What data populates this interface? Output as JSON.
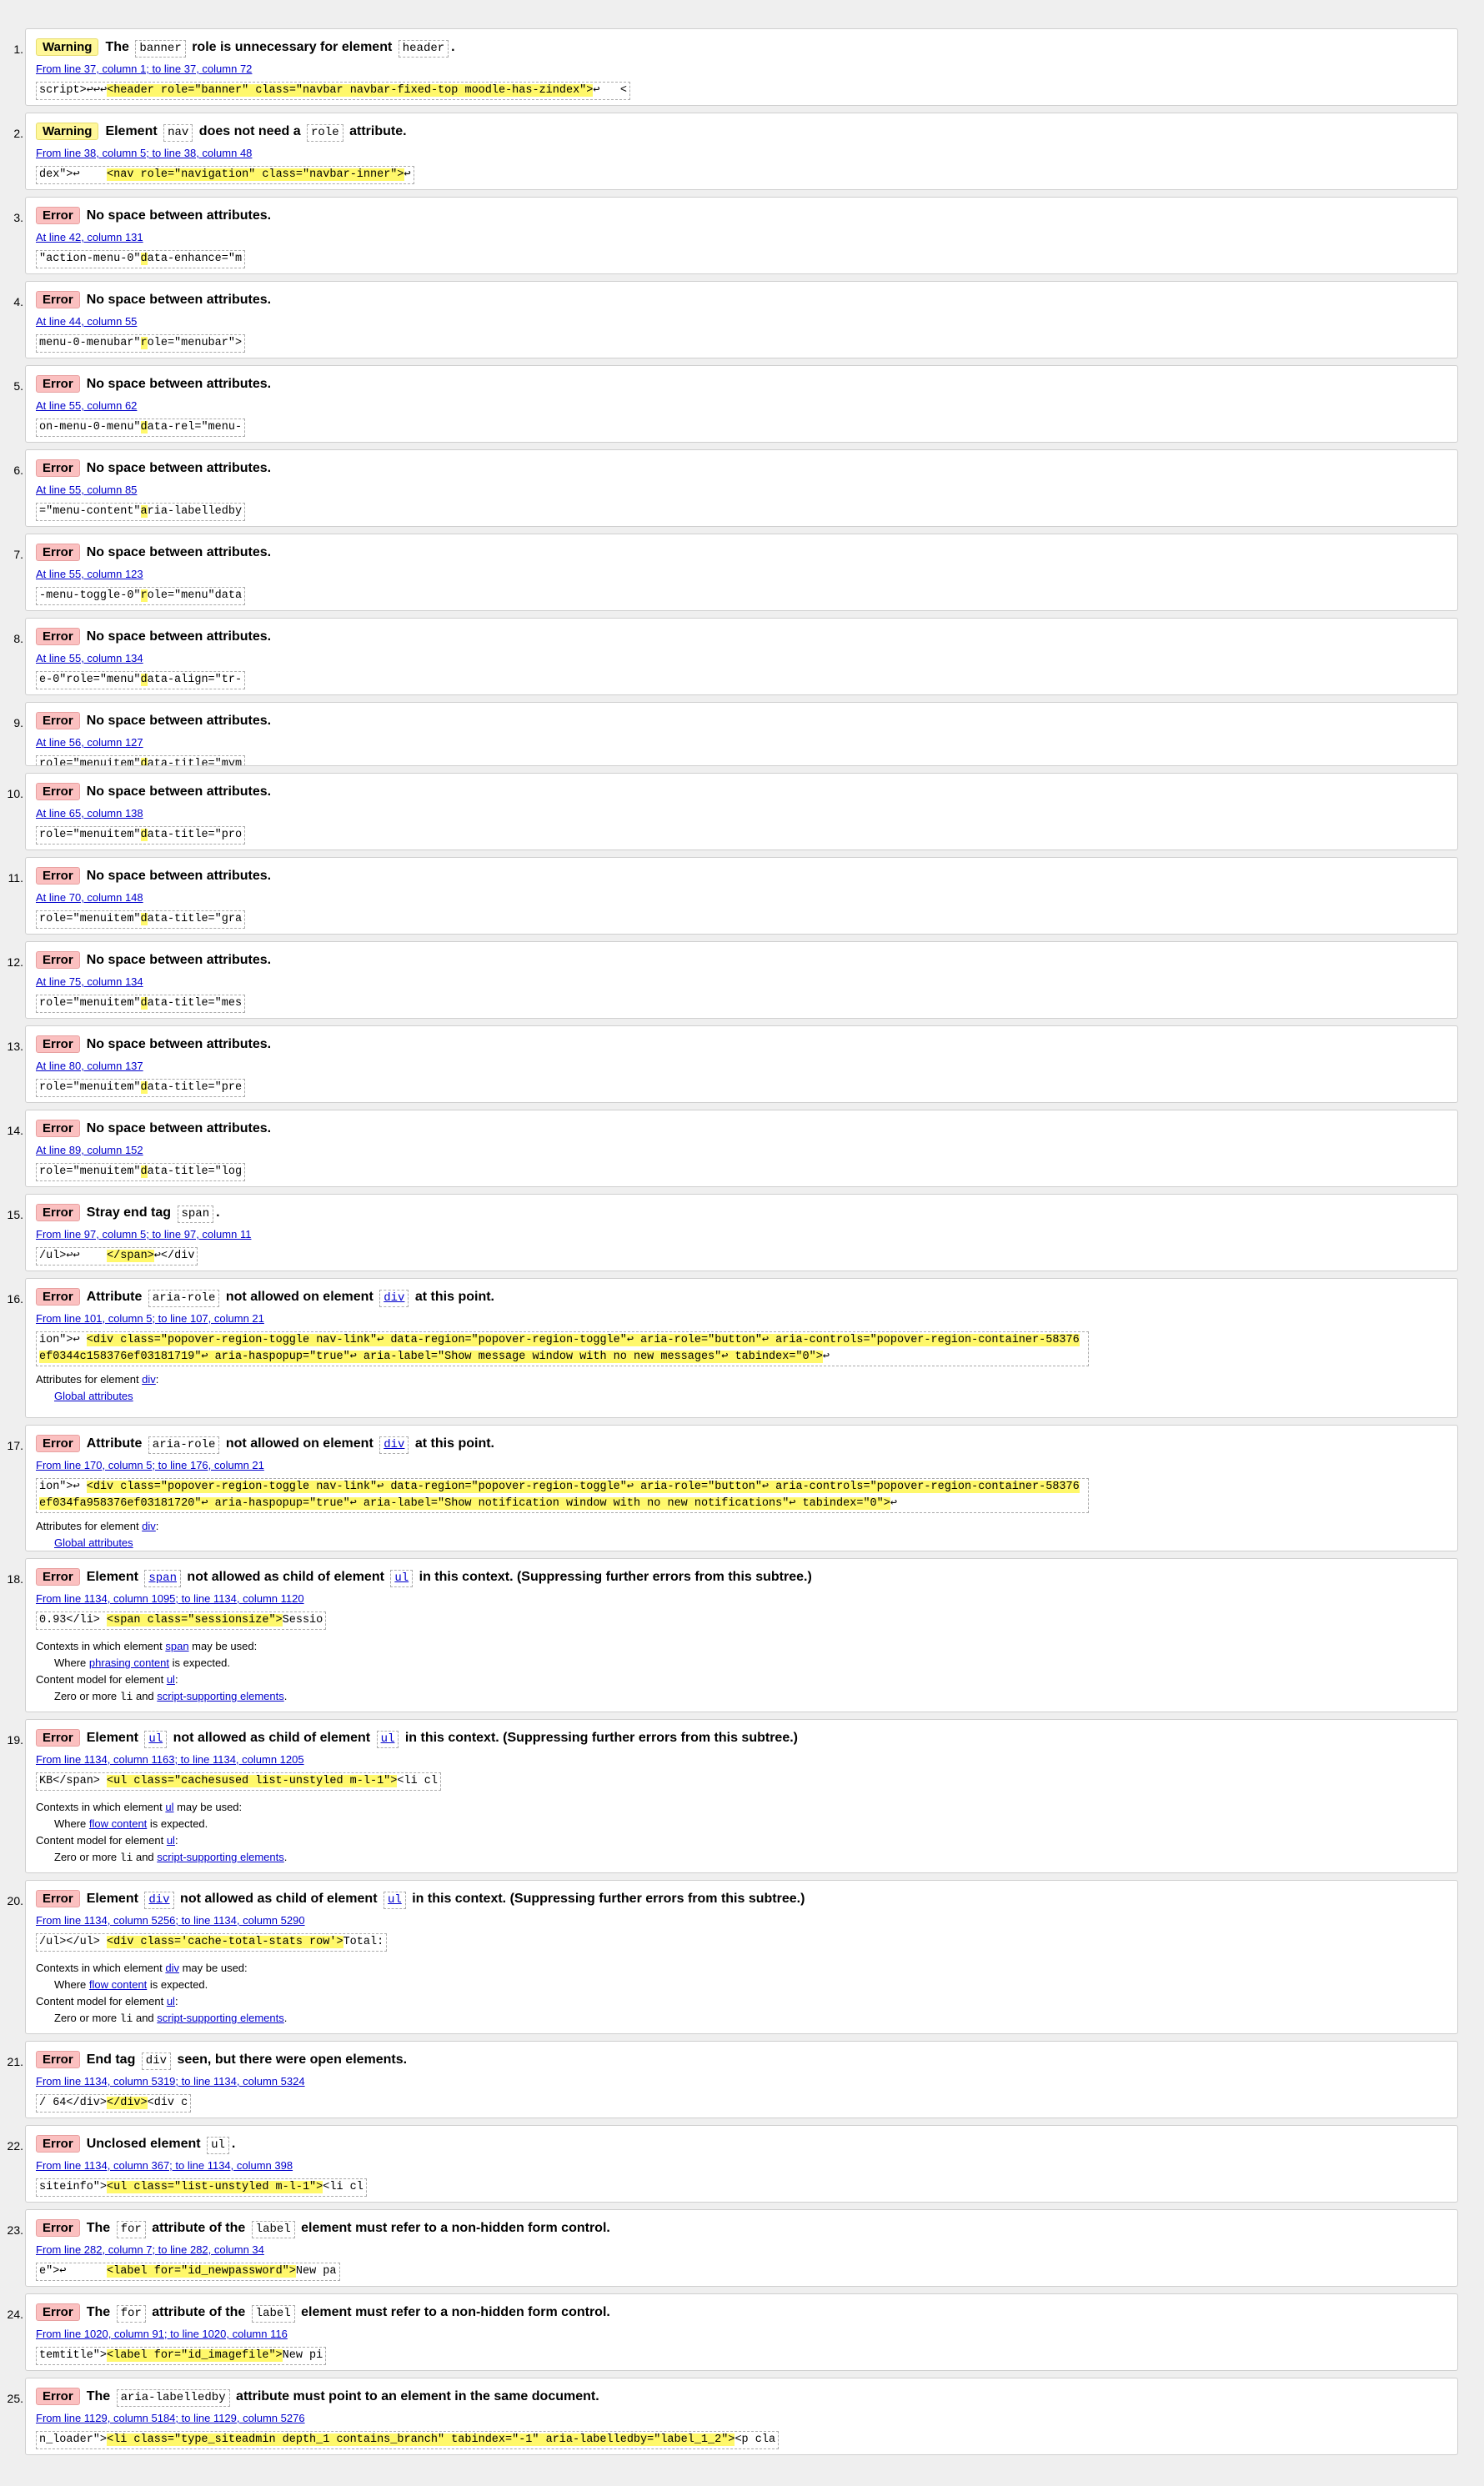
{
  "colors": {
    "error_badge": "#fbc0c0",
    "warning_badge": "#fff799",
    "highlight": "#fff86b",
    "link": "#0000cc"
  },
  "messages": [
    {
      "n": "1.",
      "type": "Warning",
      "parts": [
        "The",
        "banner",
        "role is unnecessary for element",
        "header",
        "."
      ],
      "tok": [
        1,
        3
      ],
      "loc": "From line 37, column 1; to line 37, column 72",
      "ext": [
        "script>↩↩↩",
        "<header role=\"banner\" class=\"navbar navbar-fixed-top moodle-has-zindex\">",
        "↩   <"
      ]
    },
    {
      "n": "2.",
      "type": "Warning",
      "parts": [
        "Element",
        "nav",
        "does not need a",
        "role",
        "attribute."
      ],
      "tok": [
        1,
        3
      ],
      "loc": "From line 38, column 5; to line 38, column 48",
      "ext": [
        "dex\">↩    ",
        "<nav role=\"navigation\" class=\"navbar-inner\">",
        "↩"
      ]
    },
    {
      "n": "3.",
      "type": "Error",
      "parts": [
        "No space between attributes."
      ],
      "tok": [],
      "loc": "At line 42, column 131",
      "ext": [
        "\"action-menu-0\"",
        "d",
        "ata-enhance=\"m"
      ]
    },
    {
      "n": "4.",
      "type": "Error",
      "parts": [
        "No space between attributes."
      ],
      "tok": [],
      "loc": "At line 44, column 55",
      "ext": [
        "menu-0-menubar\"",
        "r",
        "ole=\"menubar\">"
      ]
    },
    {
      "n": "5.",
      "type": "Error",
      "parts": [
        "No space between attributes."
      ],
      "tok": [],
      "loc": "At line 55, column 62",
      "ext": [
        "on-menu-0-menu\"",
        "d",
        "ata-rel=\"menu-"
      ]
    },
    {
      "n": "6.",
      "type": "Error",
      "parts": [
        "No space between attributes."
      ],
      "tok": [],
      "loc": "At line 55, column 85",
      "ext": [
        "=\"menu-content\"",
        "a",
        "ria-labelledby"
      ]
    },
    {
      "n": "7.",
      "type": "Error",
      "parts": [
        "No space between attributes."
      ],
      "tok": [],
      "loc": "At line 55, column 123",
      "ext": [
        "-menu-toggle-0\"",
        "r",
        "ole=\"menu\"data"
      ]
    },
    {
      "n": "8.",
      "type": "Error",
      "parts": [
        "No space between attributes."
      ],
      "tok": [],
      "loc": "At line 55, column 134",
      "ext": [
        "e-0\"role=\"menu\"",
        "d",
        "ata-align=\"tr-"
      ]
    },
    {
      "n": "9.",
      "type": "Error",
      "parts": [
        "No space between attributes."
      ],
      "tok": [],
      "loc": "At line 56, column 127",
      "ext": [
        "role=\"menuitem\"",
        "d",
        "ata-title=\"mym"
      ],
      "clipped": true
    },
    {
      "n": "10.",
      "type": "Error",
      "parts": [
        "No space between attributes."
      ],
      "tok": [],
      "loc": "At line 65, column 138",
      "ext": [
        "role=\"menuitem\"",
        "d",
        "ata-title=\"pro"
      ]
    },
    {
      "n": "11.",
      "type": "Error",
      "parts": [
        "No space between attributes."
      ],
      "tok": [],
      "loc": "At line 70, column 148",
      "ext": [
        "role=\"menuitem\"",
        "d",
        "ata-title=\"gra"
      ]
    },
    {
      "n": "12.",
      "type": "Error",
      "parts": [
        "No space between attributes."
      ],
      "tok": [],
      "loc": "At line 75, column 134",
      "ext": [
        "role=\"menuitem\"",
        "d",
        "ata-title=\"mes"
      ]
    },
    {
      "n": "13.",
      "type": "Error",
      "parts": [
        "No space between attributes."
      ],
      "tok": [],
      "loc": "At line 80, column 137",
      "ext": [
        "role=\"menuitem\"",
        "d",
        "ata-title=\"pre"
      ]
    },
    {
      "n": "14.",
      "type": "Error",
      "parts": [
        "No space between attributes."
      ],
      "tok": [],
      "loc": "At line 89, column 152",
      "ext": [
        "role=\"menuitem\"",
        "d",
        "ata-title=\"log"
      ]
    },
    {
      "n": "15.",
      "type": "Error",
      "parts": [
        "Stray end tag",
        "span",
        "."
      ],
      "tok": [
        1
      ],
      "loc": "From line 97, column 5; to line 97, column 11",
      "ext": [
        "/ul>↩↩    ",
        "</span>",
        "↩</div"
      ]
    },
    {
      "n": "16.",
      "type": "Error",
      "parts": [
        "Attribute",
        "aria-role",
        "not allowed on element",
        "div",
        "at this point."
      ],
      "tok": [
        1,
        3
      ],
      "tokLink": [
        3
      ],
      "loc": "From line 101, column 5; to line 107, column 21",
      "ext": [
        "ion\">↩    ",
        "<div class=\"popover-region-toggle nav-link\"↩        data-region=\"popover-region-toggle\"↩        aria-role=\"button\"↩        aria-controls=\"popover-region-container-58376ef0344c158376ef03181719\"↩        aria-haspopup=\"true\"↩        aria-label=\"Show message window with no new messages\"↩        tabindex=\"0\">",
        "↩"
      ],
      "wrap": true,
      "ctx": [
        {
          "t": "Attributes for element ",
          "a": "div",
          "e": ":"
        },
        {
          "ind": true,
          "a": "Global attributes"
        }
      ]
    },
    {
      "n": "17.",
      "type": "Error",
      "parts": [
        "Attribute",
        "aria-role",
        "not allowed on element",
        "div",
        "at this point."
      ],
      "tok": [
        1,
        3
      ],
      "tokLink": [
        3
      ],
      "loc": "From line 170, column 5; to line 176, column 21",
      "ext": [
        "ion\">↩    ",
        "<div class=\"popover-region-toggle nav-link\"↩        data-region=\"popover-region-toggle\"↩        aria-role=\"button\"↩        aria-controls=\"popover-region-container-58376ef034fa958376ef03181720\"↩        aria-haspopup=\"true\"↩        aria-label=\"Show notification window with no new notifications\"↩        tabindex=\"0\">",
        "↩"
      ],
      "wrap": true,
      "ctx": [
        {
          "t": "Attributes for element ",
          "a": "div",
          "e": ":"
        },
        {
          "ind": true,
          "a": "Global attributes"
        }
      ],
      "clipped": true
    },
    {
      "n": "18.",
      "type": "Error",
      "parts": [
        "Element",
        "span",
        "not allowed as child of element",
        "ul",
        "in this context. (Suppressing further errors from this subtree.)"
      ],
      "tok": [
        1,
        3
      ],
      "tokLink": [
        1,
        3
      ],
      "loc": "From line 1134, column 1095; to line 1134, column 1120",
      "ext": [
        "0.93</li> ",
        "<span class=\"sessionsize\">",
        "Sessio"
      ],
      "ctx": [
        {
          "t": "Contexts in which element ",
          "a": "span",
          "e": " may be used:"
        },
        {
          "ind": true,
          "t": "Where ",
          "a": "phrasing content",
          "e": " is expected."
        },
        {
          "t": "Content model for element ",
          "a": "ul",
          "e": ":"
        },
        {
          "ind": true,
          "t": "Zero or more ",
          "c": "li",
          "m": " and ",
          "a": "script-supporting elements",
          "e": "."
        }
      ]
    },
    {
      "n": "19.",
      "type": "Error",
      "parts": [
        "Element",
        "ul",
        "not allowed as child of element",
        "ul",
        "in this context. (Suppressing further errors from this subtree.)"
      ],
      "tok": [
        1,
        3
      ],
      "tokLink": [
        1,
        3
      ],
      "loc": "From line 1134, column 1163; to line 1134, column 1205",
      "ext": [
        "KB</span> ",
        "<ul class=\"cachesused list-unstyled m-l-1\">",
        "<li cl"
      ],
      "ctx": [
        {
          "t": "Contexts in which element ",
          "a": "ul",
          "e": " may be used:"
        },
        {
          "ind": true,
          "t": "Where ",
          "a": "flow content",
          "e": " is expected."
        },
        {
          "t": "Content model for element ",
          "a": "ul",
          "e": ":"
        },
        {
          "ind": true,
          "t": "Zero or more ",
          "c": "li",
          "m": " and ",
          "a": "script-supporting elements",
          "e": "."
        }
      ]
    },
    {
      "n": "20.",
      "type": "Error",
      "parts": [
        "Element",
        "div",
        "not allowed as child of element",
        "ul",
        "in this context. (Suppressing further errors from this subtree.)"
      ],
      "tok": [
        1,
        3
      ],
      "tokLink": [
        1,
        3
      ],
      "loc": "From line 1134, column 5256; to line 1134, column 5290",
      "ext": [
        "/ul></ul> ",
        "<div class='cache-total-stats row'>",
        "Total:"
      ],
      "ctx": [
        {
          "t": "Contexts in which element ",
          "a": "div",
          "e": " may be used:"
        },
        {
          "ind": true,
          "t": "Where ",
          "a": "flow content",
          "e": " is expected."
        },
        {
          "t": "Content model for element ",
          "a": "ul",
          "e": ":"
        },
        {
          "ind": true,
          "t": "Zero or more ",
          "c": "li",
          "m": " and ",
          "a": "script-supporting elements",
          "e": "."
        }
      ]
    },
    {
      "n": "21.",
      "type": "Error",
      "parts": [
        "End tag",
        "div",
        "seen, but there were open elements."
      ],
      "tok": [
        1
      ],
      "loc": "From line 1134, column 5319; to line 1134, column 5324",
      "ext": [
        "/ 64</div>",
        "</div>",
        "<div c"
      ]
    },
    {
      "n": "22.",
      "type": "Error",
      "parts": [
        "Unclosed element",
        "ul",
        "."
      ],
      "tok": [
        1
      ],
      "loc": "From line 1134, column 367; to line 1134, column 398",
      "ext": [
        "siteinfo\">",
        "<ul class=\"list-unstyled m-l-1\">",
        "<li cl"
      ]
    },
    {
      "n": "23.",
      "type": "Error",
      "parts": [
        "The",
        "for",
        "attribute of the",
        "label",
        "element must refer to a non-hidden form control."
      ],
      "tok": [
        1,
        3
      ],
      "loc": "From line 282, column 7; to line 282, column 34",
      "ext": [
        "e\">↩      ",
        "<label for=\"id_newpassword\">",
        "New pa"
      ]
    },
    {
      "n": "24.",
      "type": "Error",
      "parts": [
        "The",
        "for",
        "attribute of the",
        "label",
        "element must refer to a non-hidden form control."
      ],
      "tok": [
        1,
        3
      ],
      "loc": "From line 1020, column 91; to line 1020, column 116",
      "ext": [
        "temtitle\">",
        "<label for=\"id_imagefile\">",
        "New pi"
      ]
    },
    {
      "n": "25.",
      "type": "Error",
      "parts": [
        "The",
        "aria-labelledby",
        "attribute must point to an element in the same document."
      ],
      "tok": [
        1
      ],
      "loc": "From line 1129, column 5184; to line 1129, column 5276",
      "ext": [
        "n_loader\">",
        "<li class=\"type_siteadmin depth_1 contains_branch\" tabindex=\"-1\" aria-labelledby=\"label_1_2\">",
        "<p cla"
      ]
    }
  ]
}
